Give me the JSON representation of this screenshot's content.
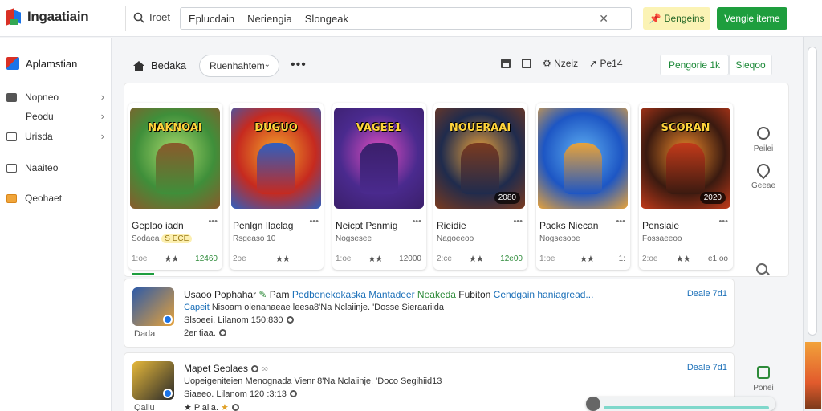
{
  "app": {
    "logo_text": "Ingaatiain"
  },
  "topbar": {
    "search_button_label": "Iroet",
    "search_terms": [
      "Eplucdain",
      "Neriengia",
      "Slongeak"
    ],
    "promo_label": "Bengeins",
    "primary_label": "Vengie iteme"
  },
  "sidebar": {
    "header": "Aplamstian",
    "items": [
      {
        "label": "Nopneo",
        "icon": "folder-icon",
        "chevron": true
      },
      {
        "label": "Peodu",
        "icon": "",
        "chevron": true
      },
      {
        "label": "Urisda",
        "icon": "list-icon",
        "chevron": true
      },
      {
        "label": "Naaiteo",
        "icon": "image-icon",
        "chevron": false
      },
      {
        "label": "Qeohaet",
        "icon": "box-icon",
        "chevron": false
      }
    ]
  },
  "content_header": {
    "title": "Bedaka",
    "dropdown_value": "Ruenhahtem",
    "more": "•••",
    "tools": [
      {
        "icon": "lock-icon",
        "label": ""
      },
      {
        "icon": "image-icon",
        "label": ""
      },
      {
        "icon": "settings-icon",
        "label": "Nzeiz"
      },
      {
        "icon": "tag-icon",
        "label": "Pe14"
      }
    ],
    "tab1": "Pengorie 1k",
    "tab2": "Sieqoo"
  },
  "cards": [
    {
      "art_label": "NAKNOAI",
      "title": "Geplao iadn",
      "sub": "Sodaea",
      "sub_tag": "S ECE",
      "meta_left": "1:oe",
      "price": "12460",
      "price_green": true,
      "badge": "",
      "colors": [
        "#3f8f3a",
        "#a9d96b",
        "#8a5a2b"
      ]
    },
    {
      "art_label": "DUGUO",
      "title": "Penlgn Ilaclag",
      "sub": "Rsgeaso 10",
      "sub_tag": "",
      "meta_left": "2oe",
      "price": "",
      "price_green": false,
      "badge": "",
      "colors": [
        "#c62a1f",
        "#f4a62a",
        "#2f5fbf"
      ]
    },
    {
      "art_label": "VAGEE1",
      "title": "Neicpt Psnmig",
      "sub": "Nogsesee",
      "sub_tag": "",
      "meta_left": "1:oe",
      "price": "12000",
      "price_green": false,
      "badge": "",
      "colors": [
        "#4a2a8e",
        "#e24ec1",
        "#3b1f6b"
      ]
    },
    {
      "art_label": "NOUERAAI",
      "title": "Rieidie",
      "sub": "Nagoeeoo",
      "sub_tag": "",
      "meta_left": "2:ce",
      "price": "12e00",
      "price_green": true,
      "badge": "2080",
      "colors": [
        "#1f2b4d",
        "#f0a43a",
        "#7a3a1f"
      ]
    },
    {
      "art_label": "",
      "title": "Packs Niecan",
      "sub": "Nogsesooe",
      "sub_tag": "",
      "meta_left": "1:oe",
      "price": "1:",
      "price_green": false,
      "badge": "",
      "colors": [
        "#1d56c4",
        "#5fb0f2",
        "#e8a33a"
      ]
    },
    {
      "art_label": "SCORAN",
      "title": "Pensiaie",
      "sub": "Fossaeeoo",
      "sub_tag": "",
      "meta_left": "2:oe",
      "price": "e1:oo",
      "price_green": false,
      "badge": "2020",
      "colors": [
        "#3a1a10",
        "#f08a2a",
        "#c23a1a"
      ]
    }
  ],
  "rail": [
    {
      "icon": "heart-icon",
      "label": "Peilei"
    },
    {
      "icon": "pin-icon",
      "label": "Geeae"
    }
  ],
  "rows": [
    {
      "title": "Usaoo Pophahar",
      "title_rest": " Pam ",
      "title_link": "Pedbenekokaska Mantadeer",
      "title_green": " Neakeda",
      "title_tail": " Fubiton ",
      "title_link2": "Cendgain haniagread...",
      "line2": "Capeit ",
      "line2_rest": "Nisoam olenanaeae leesa8'Na Nclaiinje. 'Dosse Sieraariida",
      "line3": "Slsoeei. Lilanom 150:830",
      "line4": "2er tiaa.",
      "under": "Dada",
      "date": "Deale 7d1",
      "thumb_colors": [
        "#2d5aa8",
        "#e6a23a"
      ]
    },
    {
      "title": "Mapet Seolaes",
      "title_rest": "",
      "title_link": "",
      "title_green": "",
      "title_tail": "",
      "title_link2": "",
      "line2": "",
      "line2_rest": "Uopeigeniteien Menognada Vienr 8'Na Nclaiinje. 'Doco Segihiid13",
      "line3": "Siaeeo. Lilanom 120 :3:13",
      "line4": "Plaiia.",
      "under": "Qaliu",
      "date": "Deale 7d1",
      "thumb_colors": [
        "#e6b83a",
        "#2a2a2a"
      ]
    }
  ],
  "rail_bottom": {
    "icon": "home-icon",
    "label": "Ponei"
  },
  "colors": {
    "accent_green": "#1e9e3e",
    "link_blue": "#1a6fb8",
    "promo_yellow": "#fbf3b5"
  }
}
